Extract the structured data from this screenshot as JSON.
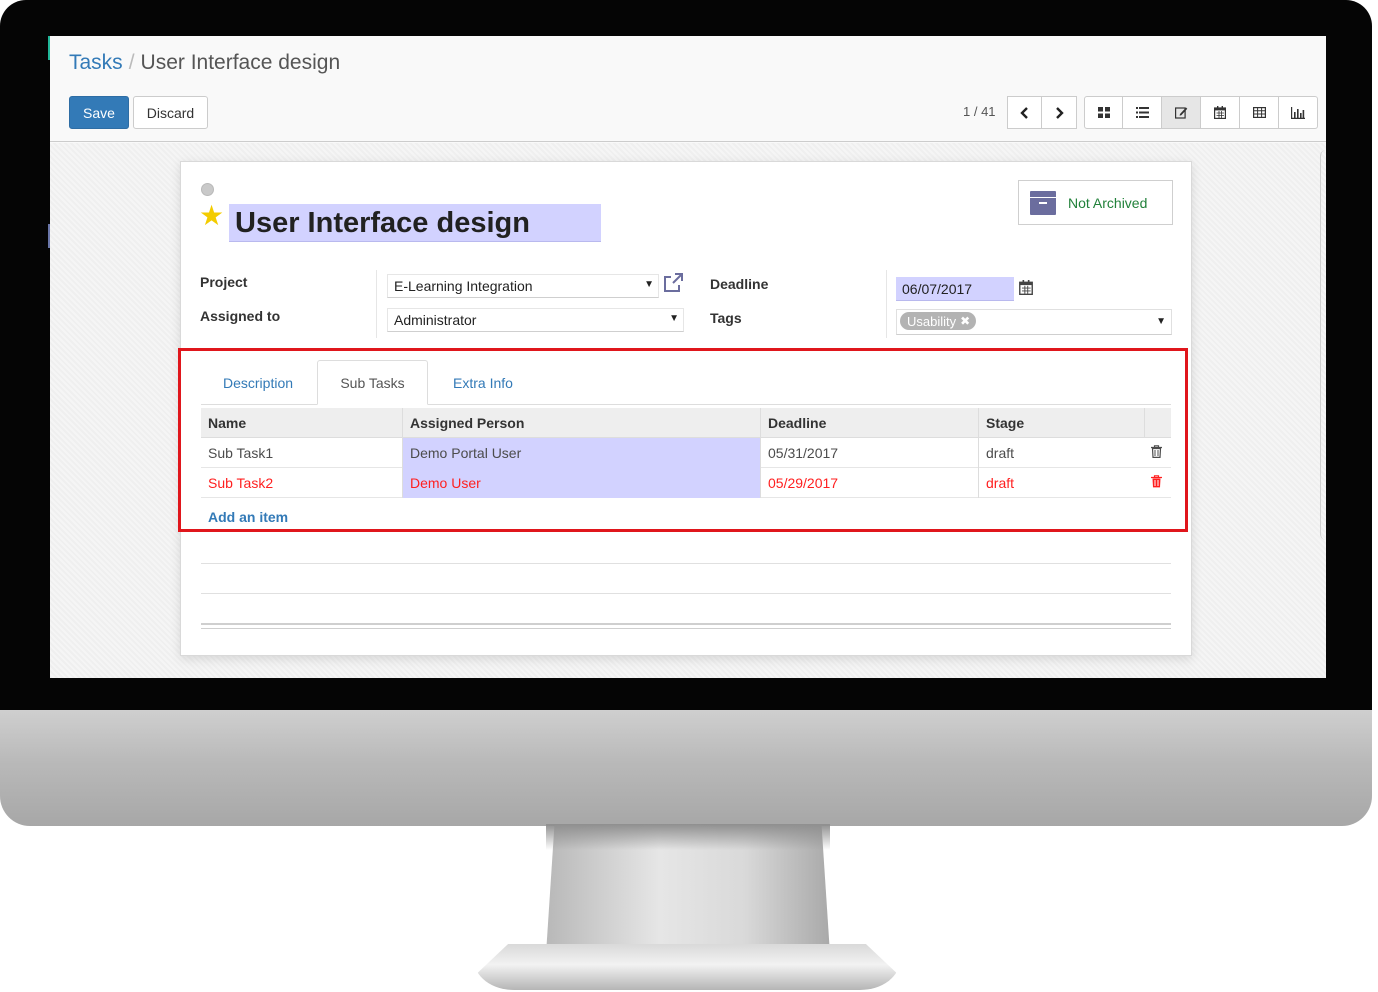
{
  "breadcrumb": {
    "parent": "Tasks",
    "separator": "/",
    "current": "User Interface design"
  },
  "buttons": {
    "save": "Save",
    "discard": "Discard"
  },
  "pager": {
    "value": "1 / 41",
    "prev_icon": "chevron-left-icon",
    "next_icon": "chevron-right-icon"
  },
  "views": [
    {
      "name": "kanban",
      "icon": "kanban-icon",
      "active": false
    },
    {
      "name": "list",
      "icon": "list-icon",
      "active": false
    },
    {
      "name": "form",
      "icon": "edit-icon",
      "active": true
    },
    {
      "name": "calendar",
      "icon": "calendar-icon",
      "active": false
    },
    {
      "name": "pivot",
      "icon": "table-icon",
      "active": false
    },
    {
      "name": "graph",
      "icon": "bar-chart-icon",
      "active": false
    }
  ],
  "task": {
    "title": "User Interface design",
    "archive_label": "Not Archived",
    "fields": {
      "project_label": "Project",
      "project_value": "E-Learning Integration",
      "assigned_label": "Assigned to",
      "assigned_value": "Administrator",
      "deadline_label": "Deadline",
      "deadline_value": "06/07/2017",
      "tags_label": "Tags",
      "tags": [
        "Usability"
      ]
    }
  },
  "tabs": [
    {
      "label": "Description",
      "active": false
    },
    {
      "label": "Sub Tasks",
      "active": true
    },
    {
      "label": "Extra Info",
      "active": false
    }
  ],
  "subtasks": {
    "columns": [
      "Name",
      "Assigned Person",
      "Deadline",
      "Stage"
    ],
    "rows": [
      {
        "name": "Sub Task1",
        "assigned": "Demo Portal User",
        "deadline": "05/31/2017",
        "stage": "draft",
        "overdue": false
      },
      {
        "name": "Sub Task2",
        "assigned": "Demo User",
        "deadline": "05/29/2017",
        "stage": "draft",
        "overdue": true
      }
    ],
    "add_label": "Add an item"
  },
  "colors": {
    "primary": "#337ab7",
    "highlight_border": "#e0161c",
    "overdue": "#ff1f1f",
    "required_field": "#d2d2ff",
    "archive_text": "#21813a",
    "star": "#f3cc00"
  }
}
